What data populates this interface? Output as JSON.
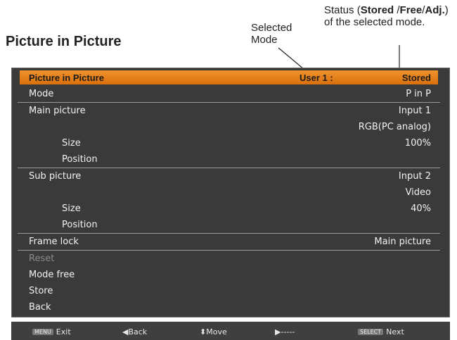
{
  "page_title": "Picture in Picture",
  "callouts": {
    "mode": "Selected Mode",
    "status_prefix": "Status (",
    "status_stored": "Stored",
    "status_sep1": " /",
    "status_free": "Free",
    "status_sep2": "/",
    "status_adj": "Adj.",
    "status_suffix": ") of the selected mode."
  },
  "menu": {
    "title": "Picture in Picture",
    "mode_name": "User 1 :",
    "status": "Stored",
    "rows": [
      {
        "label": "Mode",
        "value": "P in P"
      },
      {
        "label": "Main picture",
        "value": "Input 1"
      },
      {
        "label": "",
        "value": "RGB(PC analog)"
      },
      {
        "label": "Size",
        "value": "100%"
      },
      {
        "label": "Position",
        "value": ""
      },
      {
        "label": "Sub picture",
        "value": "Input 2"
      },
      {
        "label": "",
        "value": "Video"
      },
      {
        "label": "Size",
        "value": "40%"
      },
      {
        "label": "Position",
        "value": ""
      },
      {
        "label": "Frame lock",
        "value": "Main picture"
      },
      {
        "label": "Reset",
        "value": ""
      },
      {
        "label": "Mode free",
        "value": ""
      },
      {
        "label": "Store",
        "value": ""
      },
      {
        "label": "Back",
        "value": ""
      }
    ]
  },
  "footer": {
    "exit_key": "MENU",
    "exit_label": "Exit",
    "back_label": "Back",
    "move_label": "Move",
    "right_label": "-----",
    "next_key": "SELECT",
    "next_label": "Next"
  }
}
